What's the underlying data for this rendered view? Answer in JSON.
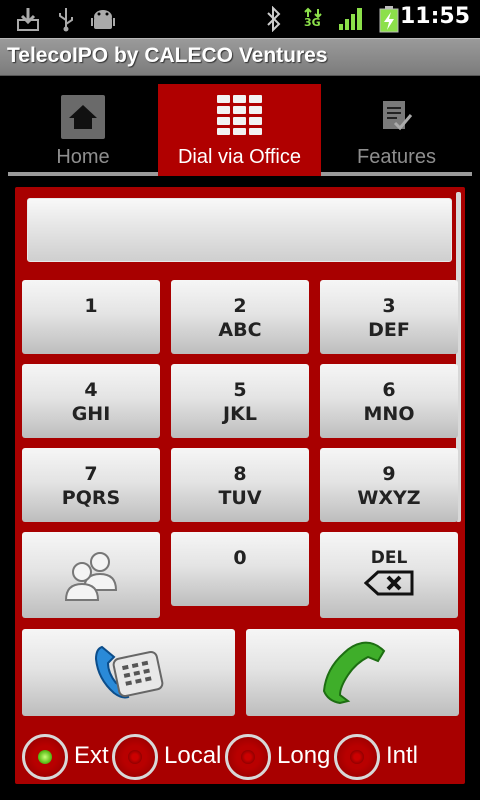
{
  "status_bar": {
    "time": "11:55",
    "network": "3G",
    "icons": [
      "download-icon",
      "usb-icon",
      "android-debug-icon",
      "bluetooth-icon",
      "network-3g-icon",
      "signal-icon",
      "battery-charging-icon"
    ]
  },
  "app": {
    "title": "TelecoIPO by CALECO Ventures"
  },
  "tabs": [
    {
      "label": "Home",
      "icon": "home-icon",
      "selected": false
    },
    {
      "label": "Dial via Office",
      "icon": "dialpad-icon",
      "selected": true
    },
    {
      "label": "Features",
      "icon": "checklist-icon",
      "selected": false
    }
  ],
  "dialer": {
    "number_value": "",
    "keys": [
      {
        "num": "1",
        "letters": ""
      },
      {
        "num": "2",
        "letters": "ABC"
      },
      {
        "num": "3",
        "letters": "DEF"
      },
      {
        "num": "4",
        "letters": "GHI"
      },
      {
        "num": "5",
        "letters": "JKL"
      },
      {
        "num": "6",
        "letters": "MNO"
      },
      {
        "num": "7",
        "letters": "PQRS"
      },
      {
        "num": "8",
        "letters": "TUV"
      },
      {
        "num": "9",
        "letters": "WXYZ"
      },
      {
        "num": "0",
        "letters": ""
      }
    ],
    "contacts_icon": "contacts-icon",
    "delete_label": "DEL",
    "office_icon": "office-phone-icon",
    "call_icon": "call-icon"
  },
  "call_type": {
    "options": [
      {
        "label": "Ext",
        "selected": true
      },
      {
        "label": "Local",
        "selected": false
      },
      {
        "label": "Long",
        "selected": false
      },
      {
        "label": "Intl",
        "selected": false
      }
    ]
  },
  "colors": {
    "accent": "#b00000",
    "panel": "#a80000",
    "radio_on": "#5fbf1a"
  }
}
